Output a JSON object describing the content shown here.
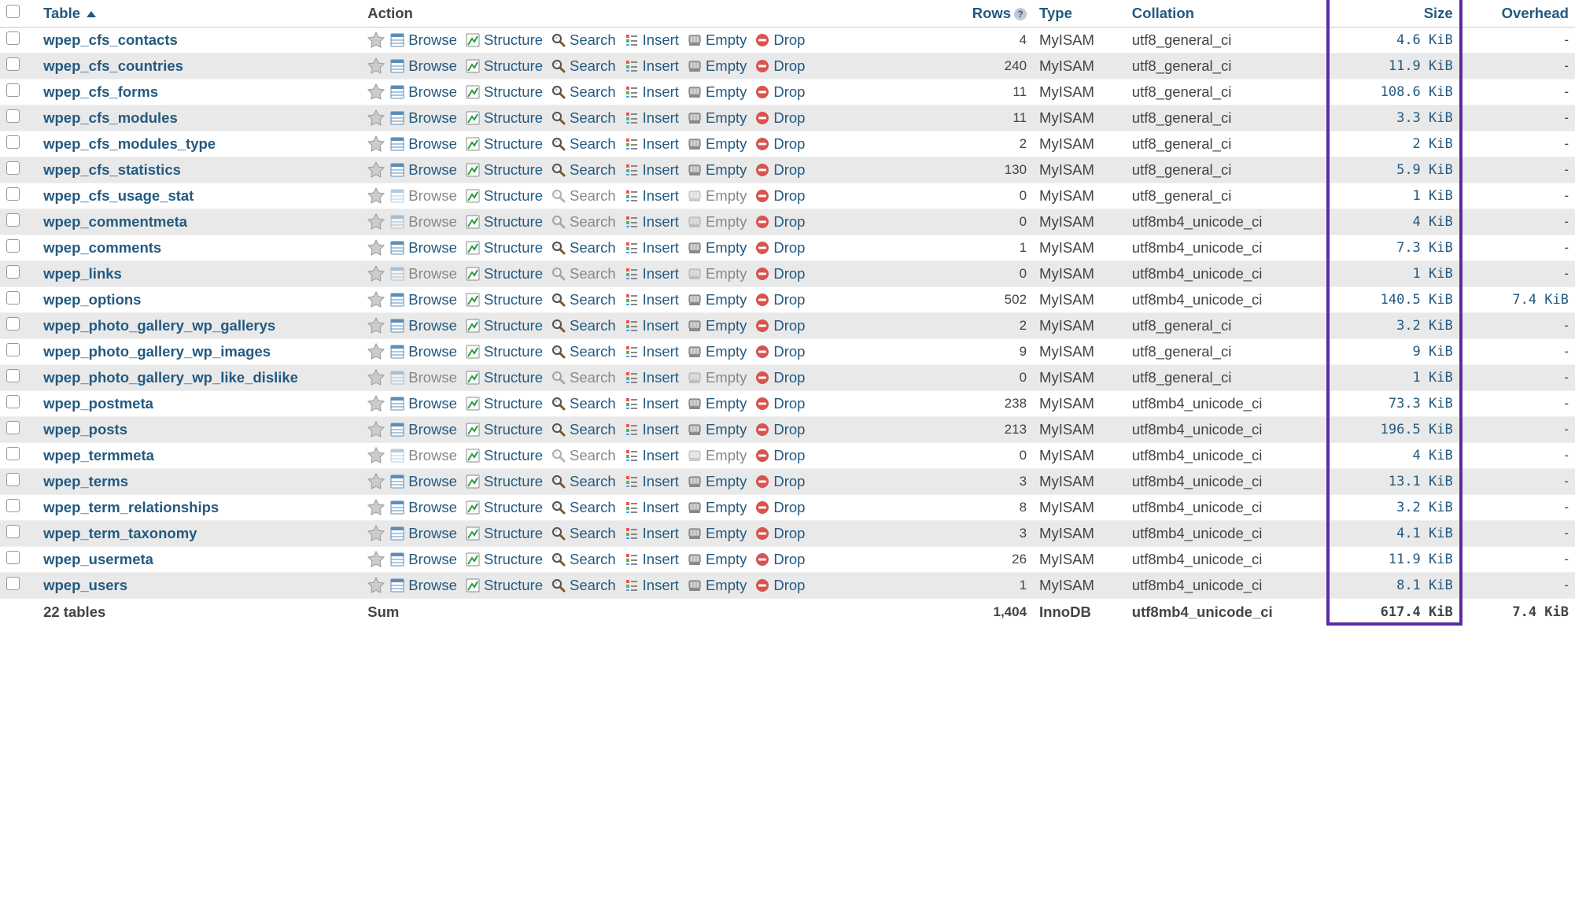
{
  "headers": {
    "table": "Table",
    "action": "Action",
    "rows": "Rows",
    "type": "Type",
    "collation": "Collation",
    "size": "Size",
    "overhead": "Overhead"
  },
  "actions": {
    "browse": "Browse",
    "structure": "Structure",
    "search": "Search",
    "insert": "Insert",
    "empty": "Empty",
    "drop": "Drop"
  },
  "footer": {
    "count_label": "22 tables",
    "sum_label": "Sum",
    "rows": "1,404",
    "type": "InnoDB",
    "collation": "utf8mb4_unicode_ci",
    "size": "617.4 KiB",
    "overhead": "7.4 KiB"
  },
  "rows": [
    {
      "name": "wpep_cfs_contacts",
      "rows": "4",
      "type": "MyISAM",
      "collation": "utf8_general_ci",
      "size": "4.6 KiB",
      "overhead": "-",
      "empty": false
    },
    {
      "name": "wpep_cfs_countries",
      "rows": "240",
      "type": "MyISAM",
      "collation": "utf8_general_ci",
      "size": "11.9 KiB",
      "overhead": "-",
      "empty": false
    },
    {
      "name": "wpep_cfs_forms",
      "rows": "11",
      "type": "MyISAM",
      "collation": "utf8_general_ci",
      "size": "108.6 KiB",
      "overhead": "-",
      "empty": false
    },
    {
      "name": "wpep_cfs_modules",
      "rows": "11",
      "type": "MyISAM",
      "collation": "utf8_general_ci",
      "size": "3.3 KiB",
      "overhead": "-",
      "empty": false
    },
    {
      "name": "wpep_cfs_modules_type",
      "rows": "2",
      "type": "MyISAM",
      "collation": "utf8_general_ci",
      "size": "2 KiB",
      "overhead": "-",
      "empty": false
    },
    {
      "name": "wpep_cfs_statistics",
      "rows": "130",
      "type": "MyISAM",
      "collation": "utf8_general_ci",
      "size": "5.9 KiB",
      "overhead": "-",
      "empty": false
    },
    {
      "name": "wpep_cfs_usage_stat",
      "rows": "0",
      "type": "MyISAM",
      "collation": "utf8_general_ci",
      "size": "1 KiB",
      "overhead": "-",
      "empty": true
    },
    {
      "name": "wpep_commentmeta",
      "rows": "0",
      "type": "MyISAM",
      "collation": "utf8mb4_unicode_ci",
      "size": "4 KiB",
      "overhead": "-",
      "empty": true
    },
    {
      "name": "wpep_comments",
      "rows": "1",
      "type": "MyISAM",
      "collation": "utf8mb4_unicode_ci",
      "size": "7.3 KiB",
      "overhead": "-",
      "empty": false
    },
    {
      "name": "wpep_links",
      "rows": "0",
      "type": "MyISAM",
      "collation": "utf8mb4_unicode_ci",
      "size": "1 KiB",
      "overhead": "-",
      "empty": true
    },
    {
      "name": "wpep_options",
      "rows": "502",
      "type": "MyISAM",
      "collation": "utf8mb4_unicode_ci",
      "size": "140.5 KiB",
      "overhead": "7.4 KiB",
      "empty": false
    },
    {
      "name": "wpep_photo_gallery_wp_gallerys",
      "rows": "2",
      "type": "MyISAM",
      "collation": "utf8_general_ci",
      "size": "3.2 KiB",
      "overhead": "-",
      "empty": false
    },
    {
      "name": "wpep_photo_gallery_wp_images",
      "rows": "9",
      "type": "MyISAM",
      "collation": "utf8_general_ci",
      "size": "9 KiB",
      "overhead": "-",
      "empty": false
    },
    {
      "name": "wpep_photo_gallery_wp_like_dislike",
      "rows": "0",
      "type": "MyISAM",
      "collation": "utf8_general_ci",
      "size": "1 KiB",
      "overhead": "-",
      "empty": true
    },
    {
      "name": "wpep_postmeta",
      "rows": "238",
      "type": "MyISAM",
      "collation": "utf8mb4_unicode_ci",
      "size": "73.3 KiB",
      "overhead": "-",
      "empty": false
    },
    {
      "name": "wpep_posts",
      "rows": "213",
      "type": "MyISAM",
      "collation": "utf8mb4_unicode_ci",
      "size": "196.5 KiB",
      "overhead": "-",
      "empty": false
    },
    {
      "name": "wpep_termmeta",
      "rows": "0",
      "type": "MyISAM",
      "collation": "utf8mb4_unicode_ci",
      "size": "4 KiB",
      "overhead": "-",
      "empty": true
    },
    {
      "name": "wpep_terms",
      "rows": "3",
      "type": "MyISAM",
      "collation": "utf8mb4_unicode_ci",
      "size": "13.1 KiB",
      "overhead": "-",
      "empty": false
    },
    {
      "name": "wpep_term_relationships",
      "rows": "8",
      "type": "MyISAM",
      "collation": "utf8mb4_unicode_ci",
      "size": "3.2 KiB",
      "overhead": "-",
      "empty": false
    },
    {
      "name": "wpep_term_taxonomy",
      "rows": "3",
      "type": "MyISAM",
      "collation": "utf8mb4_unicode_ci",
      "size": "4.1 KiB",
      "overhead": "-",
      "empty": false
    },
    {
      "name": "wpep_usermeta",
      "rows": "26",
      "type": "MyISAM",
      "collation": "utf8mb4_unicode_ci",
      "size": "11.9 KiB",
      "overhead": "-",
      "empty": false
    },
    {
      "name": "wpep_users",
      "rows": "1",
      "type": "MyISAM",
      "collation": "utf8mb4_unicode_ci",
      "size": "8.1 KiB",
      "overhead": "-",
      "empty": false
    }
  ]
}
